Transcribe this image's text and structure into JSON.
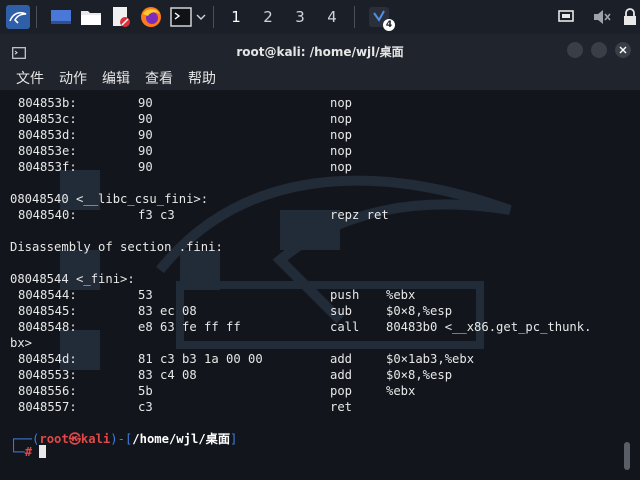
{
  "taskbar": {
    "workspaces": [
      "1",
      "2",
      "3",
      "4"
    ],
    "active_workspace": "1",
    "notification_count": "4"
  },
  "window": {
    "title": "root@kali: /home/wjl/桌面"
  },
  "menu": {
    "items": [
      "文件",
      "动作",
      "编辑",
      "查看",
      "帮助"
    ]
  },
  "terminal": {
    "lines": [
      {
        "addr": "804853b:",
        "hex": "90",
        "mn": "nop",
        "op": ""
      },
      {
        "addr": "804853c:",
        "hex": "90",
        "mn": "nop",
        "op": ""
      },
      {
        "addr": "804853d:",
        "hex": "90",
        "mn": "nop",
        "op": ""
      },
      {
        "addr": "804853e:",
        "hex": "90",
        "mn": "nop",
        "op": ""
      },
      {
        "addr": "804853f:",
        "hex": "90",
        "mn": "nop",
        "op": ""
      },
      {
        "text": ""
      },
      {
        "text": "08048540 <__libc_csu_fini>:"
      },
      {
        "addr": "8048540:",
        "hex": "f3 c3",
        "mn": "repz ret",
        "op": ""
      },
      {
        "text": ""
      },
      {
        "text": "Disassembly of section .fini:"
      },
      {
        "text": ""
      },
      {
        "text": "08048544 <_fini>:"
      },
      {
        "addr": "8048544:",
        "hex": "53",
        "mn": "push",
        "op": "%ebx"
      },
      {
        "addr": "8048545:",
        "hex": "83 ec 08",
        "mn": "sub",
        "op": "$0×8,%esp"
      },
      {
        "addr": "8048548:",
        "hex": "e8 63 fe ff ff",
        "mn": "call",
        "op": "80483b0 <__x86.get_pc_thunk."
      },
      {
        "text": "bx>"
      },
      {
        "addr": "804854d:",
        "hex": "81 c3 b3 1a 00 00",
        "mn": "add",
        "op": "$0×1ab3,%ebx"
      },
      {
        "addr": "8048553:",
        "hex": "83 c4 08",
        "mn": "add",
        "op": "$0×8,%esp"
      },
      {
        "addr": "8048556:",
        "hex": "5b",
        "mn": "pop",
        "op": "%ebx"
      },
      {
        "addr": "8048557:",
        "hex": "c3",
        "mn": "ret",
        "op": ""
      }
    ],
    "prompt": {
      "open": "┌──(",
      "user": "root",
      "at": "㉿",
      "host": "kali",
      "sep": ")-[",
      "path": "/home/wjl/桌面",
      "close": "]",
      "second": "└─",
      "symbol": "#"
    }
  }
}
